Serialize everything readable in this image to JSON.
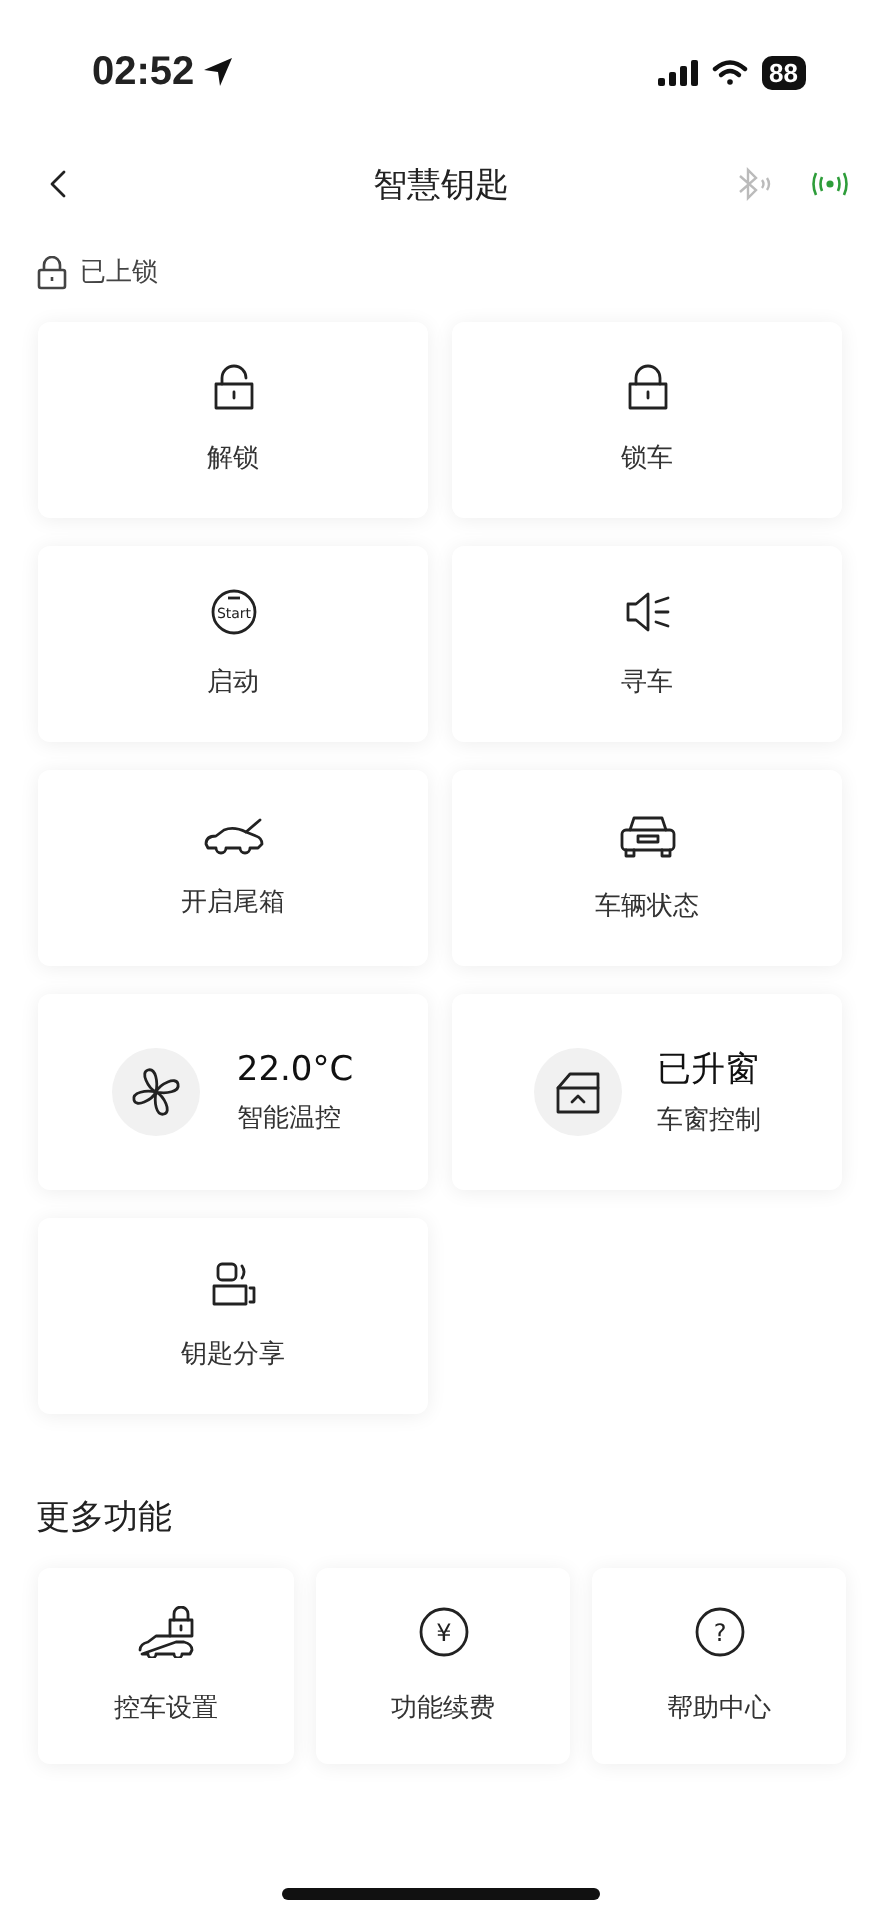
{
  "status_bar": {
    "time": "02:52",
    "battery": "88"
  },
  "nav": {
    "title": "智慧钥匙",
    "connections": [
      {
        "kind": "bluetooth",
        "on": false
      },
      {
        "kind": "radio",
        "on": true
      }
    ]
  },
  "lock_status": {
    "label": "已上锁",
    "locked": true
  },
  "controls": [
    {
      "kind": "action",
      "label": "解锁"
    },
    {
      "kind": "action",
      "label": "锁车"
    },
    {
      "kind": "action",
      "label": "启动",
      "icon_text": "Start"
    },
    {
      "kind": "action",
      "label": "寻车"
    },
    {
      "kind": "action",
      "label": "开启尾箱"
    },
    {
      "kind": "action",
      "label": "车辆状态"
    },
    {
      "kind": "status",
      "value": "22.0°C",
      "label": "智能温控"
    },
    {
      "kind": "status",
      "value": "已升窗",
      "label": "车窗控制"
    },
    {
      "kind": "action",
      "label": "钥匙分享"
    }
  ],
  "more": {
    "title": "更多功能",
    "items": [
      {
        "label": "控车设置"
      },
      {
        "label": "功能续费",
        "icon_text": "¥"
      },
      {
        "label": "帮助中心",
        "icon_text": "?"
      }
    ]
  }
}
